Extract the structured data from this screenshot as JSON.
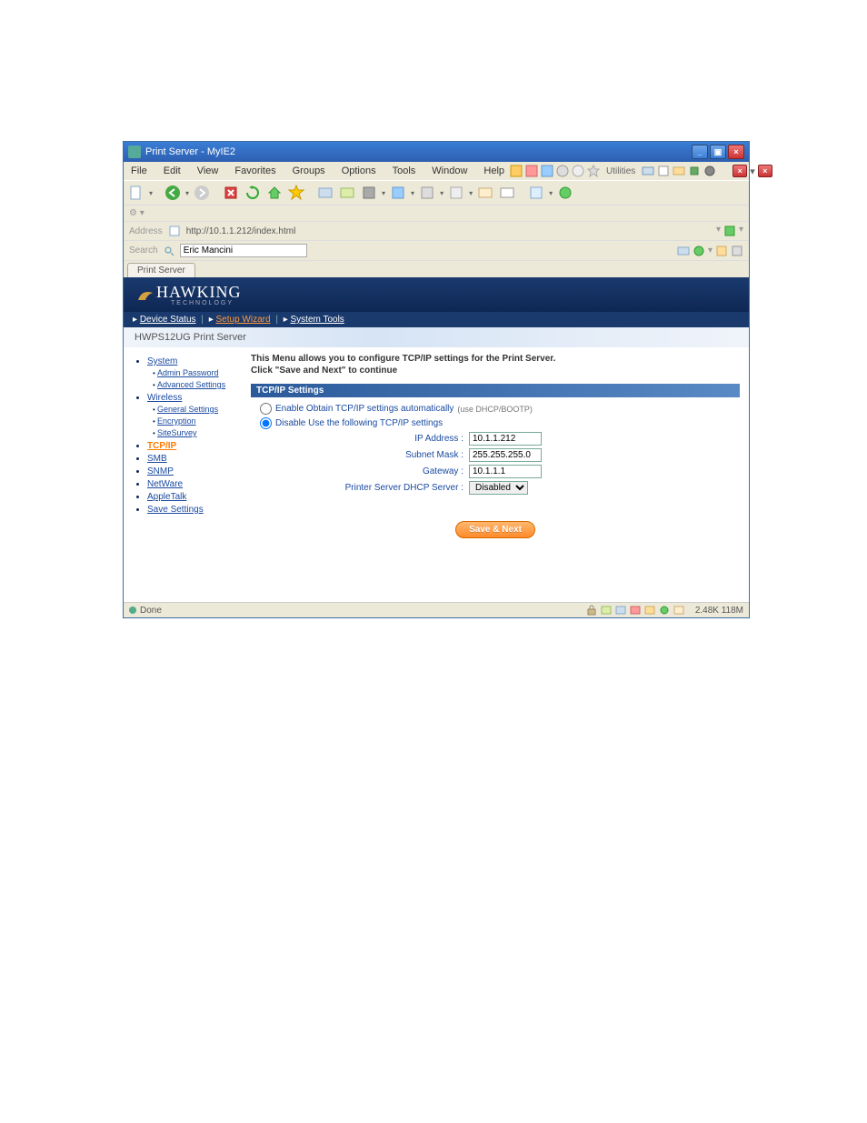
{
  "window": {
    "title": "Print Server - MyIE2"
  },
  "menubar": [
    "File",
    "Edit",
    "View",
    "Favorites",
    "Groups",
    "Options",
    "Tools",
    "Window",
    "Help"
  ],
  "menubar_right": {
    "label": "Utilities"
  },
  "addressbar": {
    "label": "Address",
    "value": "http://10.1.1.212/index.html"
  },
  "searchbar": {
    "label": "Search",
    "value": "Eric Mancini"
  },
  "tab": {
    "label": "Print Server"
  },
  "logo": {
    "brand": "HAWKING",
    "sub": "TECHNOLOGY"
  },
  "topnav": {
    "a": "Device Status",
    "b": "Setup Wizard",
    "c": "System Tools"
  },
  "model": "HWPS12UG Print Server",
  "sidebar": {
    "system": "System",
    "admin_password": "Admin Password",
    "advanced_settings": "Advanced Settings",
    "wireless": "Wireless",
    "general_settings": "General Settings",
    "encryption": "Encryption",
    "site_survey": "SiteSurvey",
    "tcpip": "TCP/IP",
    "smb": "SMB",
    "snmp": "SNMP",
    "netware": "NetWare",
    "appletalk": "AppleTalk",
    "save_settings": "Save Settings"
  },
  "panel": {
    "intro1": "This Menu allows you to configure TCP/IP settings for the Print Server.",
    "intro2": "Click \"Save and Next\" to continue",
    "header": "TCP/IP Settings",
    "opt_auto": "Enable Obtain TCP/IP settings automatically",
    "opt_auto_hint": "(use DHCP/BOOTP)",
    "opt_manual": "Disable Use the following TCP/IP settings",
    "ip_label": "IP Address :",
    "ip_value": "10.1.1.212",
    "mask_label": "Subnet Mask :",
    "mask_value": "255.255.255.0",
    "gw_label": "Gateway :",
    "gw_value": "10.1.1.1",
    "dhcp_label": "Printer Server DHCP Server :",
    "dhcp_value": "Disabled",
    "save_btn": "Save & Next"
  },
  "statusbar": {
    "done": "Done",
    "stats": "2.48K  118M"
  }
}
